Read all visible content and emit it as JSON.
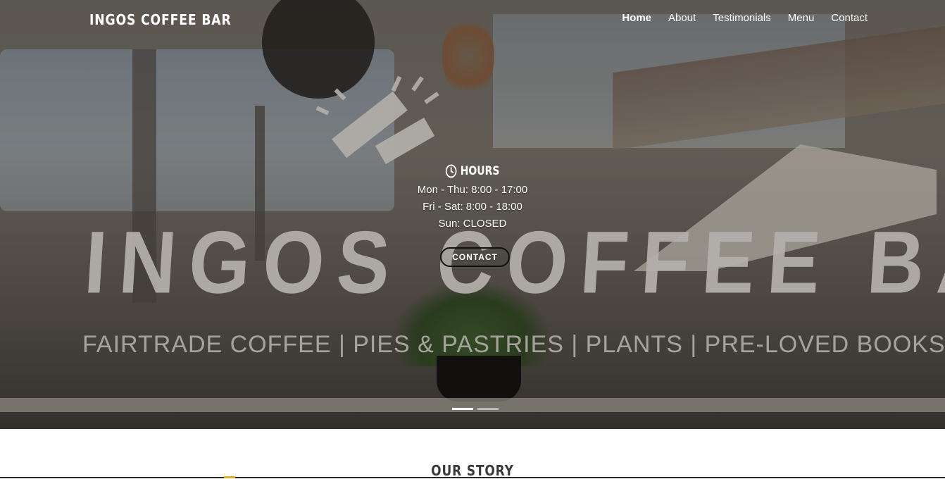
{
  "navbar": {
    "brand": "INGOS COFFEE BAR",
    "links": [
      {
        "label": "Home",
        "active": true
      },
      {
        "label": "About",
        "active": false
      },
      {
        "label": "Testimonials",
        "active": false
      },
      {
        "label": "Menu",
        "active": false
      },
      {
        "label": "Contact",
        "active": false
      }
    ]
  },
  "hero": {
    "sign_text": "INGOS COFFEE BAR",
    "sign_subtext": "FAIRTRADE COFFEE | PIES & PASTRIES | PLANTS | PRE-LOVED BOOKS",
    "hours": {
      "icon": "clock-icon",
      "title": "HOURS",
      "lines": [
        "Mon - Thu: 8:00 - 17:00",
        "Fri - Sat: 8:00 - 18:00",
        "Sun: CLOSED"
      ]
    },
    "contact_button": "CONTACT",
    "carousel": {
      "slide_count": 2,
      "active_index": 0
    }
  },
  "story": {
    "title": "OUR STORY"
  },
  "colors": {
    "text_light": "#ffffff",
    "heading_dark": "#3a3a3a",
    "accent": "#e2b02a"
  }
}
